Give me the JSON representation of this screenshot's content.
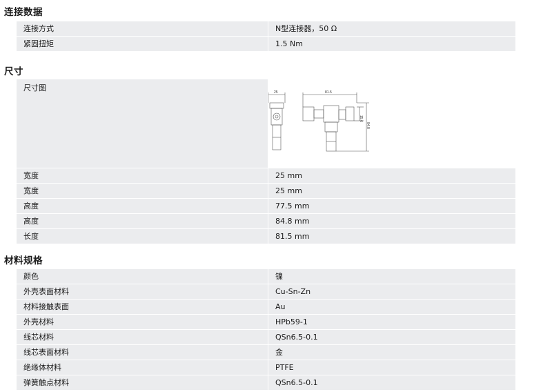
{
  "sections": {
    "connection": {
      "title": "连接数据",
      "rows": [
        {
          "key": "连接方式",
          "value": "N型连接器，50 Ω"
        },
        {
          "key": "紧固扭矩",
          "value": "1.5 Nm"
        }
      ]
    },
    "dimensions": {
      "title": "尺寸",
      "drawing_label": "尺寸图",
      "drawing_dims": {
        "top_left": "25",
        "top_right": "81.5",
        "side_inner": "15.6",
        "side_outer": "84.8"
      },
      "rows": [
        {
          "key": "宽度",
          "value": "25 mm"
        },
        {
          "key": "宽度",
          "value": "25 mm"
        },
        {
          "key": "高度",
          "value": "77.5 mm"
        },
        {
          "key": "高度",
          "value": "84.8 mm"
        },
        {
          "key": "长度",
          "value": "81.5 mm"
        }
      ]
    },
    "materials": {
      "title": "材料规格",
      "rows": [
        {
          "key": "颜色",
          "value": "镍"
        },
        {
          "key": "外壳表面材料",
          "value": "Cu-Sn-Zn"
        },
        {
          "key": "材料接触表面",
          "value": "Au"
        },
        {
          "key": "外壳材料",
          "value": "HPb59-1"
        },
        {
          "key": "线芯材料",
          "value": "QSn6.5-0.1"
        },
        {
          "key": "线芯表面材料",
          "value": "金"
        },
        {
          "key": "绝缘体材料",
          "value": "PTFE"
        },
        {
          "key": "弹簧触点材料",
          "value": "QSn6.5-0.1"
        }
      ]
    }
  }
}
